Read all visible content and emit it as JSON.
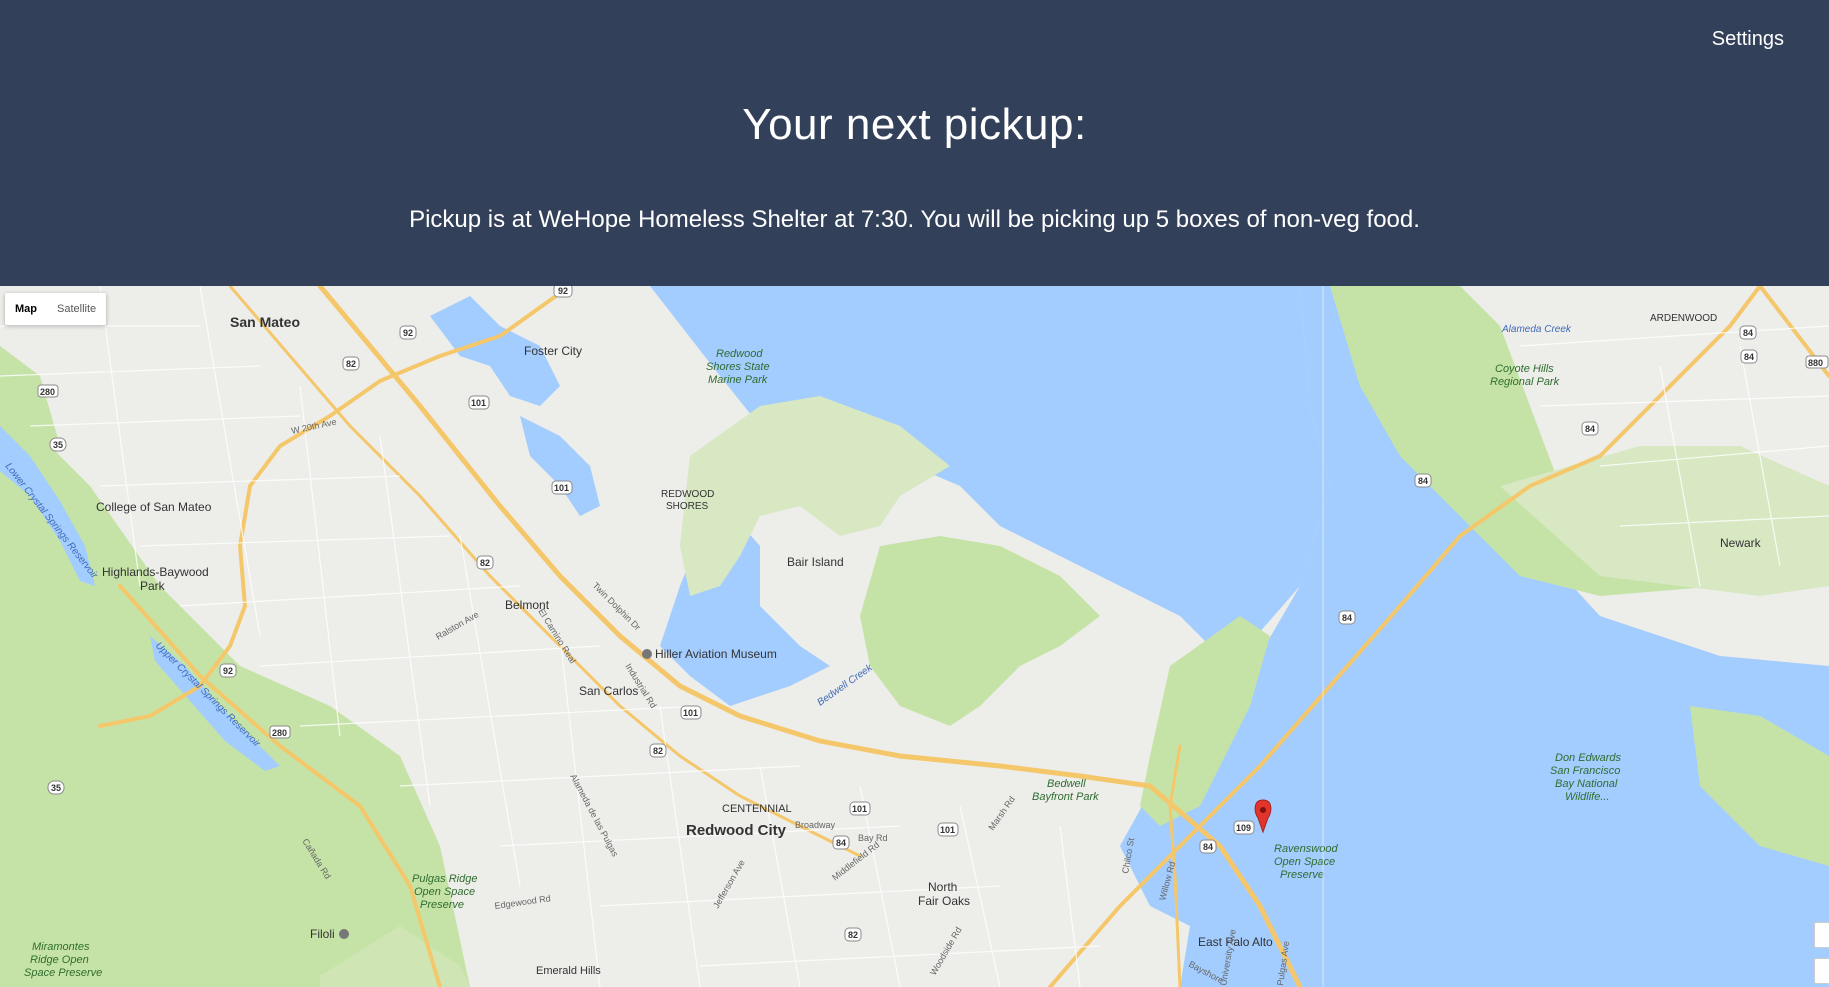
{
  "header": {
    "settings_label": "Settings",
    "title": "Your next pickup:",
    "subtitle": "Pickup is at WeHope Homeless Shelter at 7:30. You will be picking up 5 boxes of non-veg food."
  },
  "map": {
    "type_controls": {
      "map_label": "Map",
      "satellite_label": "Satellite",
      "selected": "Map"
    },
    "colors": {
      "water": "#a3ccff",
      "land": "#ededea",
      "park": "#c6e3a7",
      "highway": "#f5c76b",
      "marker": "#e2342a",
      "header": "#334059"
    },
    "places": {
      "san_mateo": "San Mateo",
      "foster_city": "Foster City",
      "college_of_san_mateo": "College of San Mateo",
      "highlands_baywood_park": [
        "Highlands-Baywood",
        "Park"
      ],
      "belmont": "Belmont",
      "hiller_museum": "Hiller Aviation Museum",
      "san_carlos": "San Carlos",
      "redwood_shores": [
        "REDWOOD",
        "SHORES"
      ],
      "bair_island": "Bair Island",
      "centennial": "CENTENNIAL",
      "redwood_city": "Redwood City",
      "north_fair_oaks": [
        "North",
        "Fair Oaks"
      ],
      "east_palo_alto": "East Palo Alto",
      "newark": "Newark",
      "ardenwood": "ARDENWOOD",
      "filoli": "Filoli",
      "emerald_hills": "Emerald Hills"
    },
    "parks": {
      "redwood_shores_marine_park": [
        "Redwood",
        "Shores State",
        "Marine Park"
      ],
      "coyote_hills": [
        "Coyote Hills",
        "Regional Park"
      ],
      "bedwell_bayfront": [
        "Bedwell",
        "Bayfront Park"
      ],
      "ravenswood": [
        "Ravenswood",
        "Open Space",
        "Preserve"
      ],
      "don_edwards": [
        "Don Edwards",
        "San Francisco",
        "Bay National",
        "Wildlife..."
      ],
      "pulgas_ridge": [
        "Pulgas Ridge",
        "Open Space",
        "Preserve"
      ],
      "miramontes": [
        "Miramontes",
        "Ridge Open",
        "Space Preserve"
      ]
    },
    "water_labels": {
      "lower_crystal": "Lower Crystal Springs Reservoir",
      "upper_crystal": "Upper Crystal Springs Reservoir",
      "alameda_creek": "Alameda Creek",
      "bedwell_creek": "Bedwell Creek"
    },
    "roads": {
      "el_camino": "El Camino Real",
      "bayshore": "Bayshore",
      "willow": "Willow Rd",
      "broadway": "Broadway",
      "bay_rd": "Bay Rd",
      "middlefield": "Middlefield Rd",
      "woodside": "Woodside Rd",
      "jefferson": "Jefferson Ave",
      "alameda": "Alameda de las Pulgas",
      "ralston": "Ralston Ave",
      "w20th": "W 20th Ave",
      "industrial": "Industrial Rd",
      "twin_dolphin": "Twin Dolphin Dr",
      "marsh": "Marsh Rd",
      "chilco": "Chilco St",
      "university": "University Ave",
      "pulgas": "Pulgas Ave",
      "edgewood": "Edgewood Rd",
      "canada": "Cañada Rd"
    },
    "shields": [
      "92",
      "101",
      "82",
      "280",
      "35",
      "84",
      "109",
      "880",
      "84",
      "92",
      "101",
      "82",
      "101",
      "101",
      "82",
      "84",
      "101",
      "84",
      "84",
      "280",
      "35",
      "92",
      "82",
      "84",
      "84"
    ]
  }
}
